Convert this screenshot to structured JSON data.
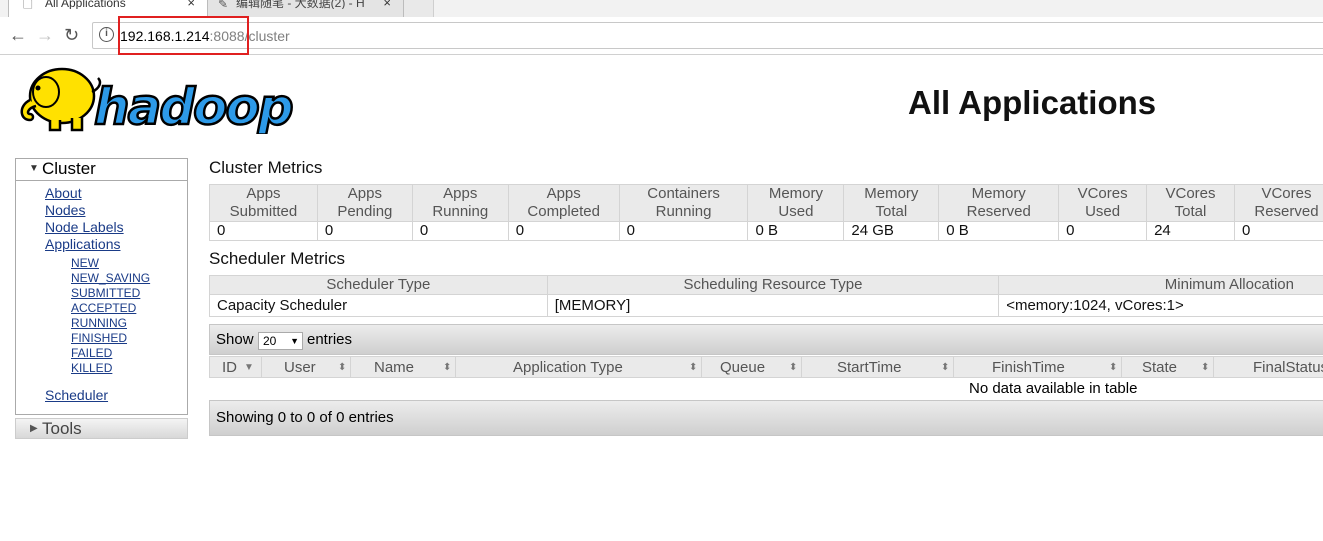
{
  "browser": {
    "tabs": [
      {
        "title": "All Applications",
        "active": true
      },
      {
        "title": "编辑随笔 - 大数据(2) - H",
        "active": false
      }
    ],
    "url_host": "192.168.1.214",
    "url_rest": ":8088/cluster",
    "close_glyph": "×"
  },
  "header": {
    "logo_text": "hadoop",
    "title": "All Applications"
  },
  "sidebar": {
    "cluster_label": "Cluster",
    "links": [
      "About",
      "Nodes",
      "Node Labels",
      "Applications"
    ],
    "app_states": [
      "NEW",
      "NEW_SAVING",
      "SUBMITTED",
      "ACCEPTED",
      "RUNNING",
      "FINISHED",
      "FAILED",
      "KILLED"
    ],
    "scheduler": "Scheduler",
    "tools_label": "Tools"
  },
  "cluster_metrics": {
    "title": "Cluster Metrics",
    "headers": [
      [
        "Apps",
        "Submitted"
      ],
      [
        "Apps",
        "Pending"
      ],
      [
        "Apps",
        "Running"
      ],
      [
        "Apps",
        "Completed"
      ],
      [
        "Containers",
        "Running"
      ],
      [
        "Memory",
        "Used"
      ],
      [
        "Memory",
        "Total"
      ],
      [
        "Memory",
        "Reserved"
      ],
      [
        "VCores",
        "Used"
      ],
      [
        "VCores",
        "Total"
      ],
      [
        "VCores",
        "Reserved"
      ]
    ],
    "values": [
      "0",
      "0",
      "0",
      "0",
      "0",
      "0 B",
      "24 GB",
      "0 B",
      "0",
      "24",
      "0"
    ]
  },
  "scheduler_metrics": {
    "title": "Scheduler Metrics",
    "headers": [
      "Scheduler Type",
      "Scheduling Resource Type",
      "Minimum Allocation"
    ],
    "values": [
      "Capacity Scheduler",
      "[MEMORY]",
      "<memory:1024, vCores:1>"
    ]
  },
  "apps_table": {
    "show_label": "Show",
    "page_size": "20",
    "entries_label": "entries",
    "columns": [
      "ID",
      "User",
      "Name",
      "Application Type",
      "Queue",
      "StartTime",
      "FinishTime",
      "State",
      "FinalStatus"
    ],
    "empty_message": "No data available in table",
    "info": "Showing 0 to 0 of 0 entries"
  },
  "colors": {
    "link": "#1a3b87",
    "highlight_box": "#e02020",
    "logo_yellow": "#ffe100",
    "logo_blue": "#2d9ae8"
  }
}
